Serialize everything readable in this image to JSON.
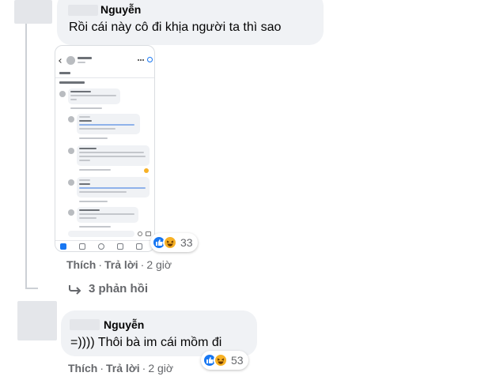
{
  "comment1": {
    "author": "Nguyễn",
    "text": "Rồi cái này cô đi khịa người ta thì sao",
    "actions": {
      "like": "Thích",
      "reply": "Trả lời",
      "time": "2 giờ"
    },
    "reaction_count": "33",
    "replies_label": "3 phản hồi"
  },
  "comment2": {
    "author": "Nguyễn",
    "text": "=)))) Thôi bà im cái mồm đi",
    "actions": {
      "like": "Thích",
      "reply": "Trả lời",
      "time": "2 giờ"
    },
    "reaction_count": "53"
  },
  "colors": {
    "bubble": "#f0f2f5",
    "secondary_text": "#65676b",
    "like_blue": "#1877f2",
    "haha_yellow": "#f7b125"
  },
  "icons": [
    "like-reaction-icon",
    "haha-reaction-icon",
    "reply-arrow-icon"
  ]
}
